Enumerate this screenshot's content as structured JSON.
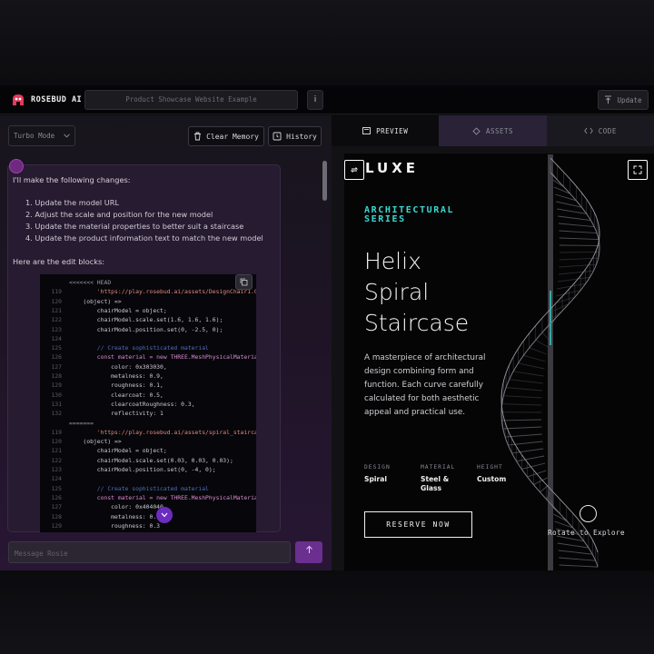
{
  "app": {
    "brand": "ROSEBUD AI",
    "project_title": "Product Showcase Website Example",
    "info_label": "i",
    "update_label": "Update"
  },
  "toolbar": {
    "mode_value": "Turbo Mode",
    "clear_memory_label": "Clear Memory",
    "history_label": "History"
  },
  "chat": {
    "intro": "I'll make the following changes:",
    "steps": [
      "1. Update the model URL",
      "2. Adjust the scale and position for the new model",
      "3. Update the material properties to better suit a staircase",
      "4. Update the product information text to match the new model"
    ],
    "edit_blocks_label": "Here are the edit blocks:",
    "input_placeholder": "Message Rosie"
  },
  "code_lines": [
    {
      "ln": "",
      "text": "<<<<<<< HEAD",
      "cls": "c-marker"
    },
    {
      "ln": "119",
      "text": "        'https://play.rosebud.ai/assets/DesignChair1.Gaybl",
      "cls": "c-str"
    },
    {
      "ln": "120",
      "text": "    (object) =>",
      "cls": "c-def"
    },
    {
      "ln": "121",
      "text": "        chairModel = object;",
      "cls": "c-def"
    },
    {
      "ln": "122",
      "text": "        chairModel.scale.set(1.6, 1.6, 1.6);",
      "cls": "c-def"
    },
    {
      "ln": "123",
      "text": "        chairModel.position.set(0, -2.5, 0);",
      "cls": "c-def"
    },
    {
      "ln": "124",
      "text": "",
      "cls": "c-def"
    },
    {
      "ln": "125",
      "text": "        // Create sophisticated material",
      "cls": "c-com"
    },
    {
      "ln": "126",
      "text": "        const material = new THREE.MeshPhysicalMateria",
      "cls": "c-key"
    },
    {
      "ln": "127",
      "text": "            color: 0x303030,",
      "cls": "c-def"
    },
    {
      "ln": "128",
      "text": "            metalness: 0.9,",
      "cls": "c-def"
    },
    {
      "ln": "129",
      "text": "            roughness: 0.1,",
      "cls": "c-def"
    },
    {
      "ln": "130",
      "text": "            clearcoat: 0.5,",
      "cls": "c-def"
    },
    {
      "ln": "131",
      "text": "            clearcoatRoughness: 0.3,",
      "cls": "c-def"
    },
    {
      "ln": "132",
      "text": "            reflectivity: 1",
      "cls": "c-def"
    },
    {
      "ln": "",
      "text": "=======",
      "cls": "c-marker"
    },
    {
      "ln": "119",
      "text": "        'https://play.rosebud.ai/assets/spiral_staircase_.g",
      "cls": "c-str"
    },
    {
      "ln": "120",
      "text": "    (object) =>",
      "cls": "c-def"
    },
    {
      "ln": "121",
      "text": "        chairModel = object;",
      "cls": "c-def"
    },
    {
      "ln": "122",
      "text": "        chairModel.scale.set(0.03, 0.03, 0.03);",
      "cls": "c-def"
    },
    {
      "ln": "123",
      "text": "        chairModel.position.set(0, -4, 0);",
      "cls": "c-def"
    },
    {
      "ln": "124",
      "text": "",
      "cls": "c-def"
    },
    {
      "ln": "125",
      "text": "        // Create sophisticated material",
      "cls": "c-com"
    },
    {
      "ln": "126",
      "text": "        const material = new THREE.MeshPhysicalMateria",
      "cls": "c-key"
    },
    {
      "ln": "127",
      "text": "            color: 0x404040,",
      "cls": "c-def"
    },
    {
      "ln": "128",
      "text": "            metalness: 0.7,",
      "cls": "c-def"
    },
    {
      "ln": "129",
      "text": "            roughness: 0.3",
      "cls": "c-def"
    }
  ],
  "tabs": [
    {
      "label": "PREVIEW",
      "icon": "preview-icon"
    },
    {
      "label": "ASSETS",
      "icon": "assets-icon"
    },
    {
      "label": "CODE",
      "icon": "code-icon"
    }
  ],
  "preview": {
    "logo": "LUXE",
    "series_line1": "ARCHITECTURAL",
    "series_line2": "SERIES",
    "title_lines": [
      "Helix",
      "Spiral",
      "Staircase"
    ],
    "description": "A masterpiece of architectural design combining form and function. Each curve carefully calculated for both aesthetic appeal and practical use.",
    "specs": [
      {
        "label": "DESIGN",
        "value": "Spiral"
      },
      {
        "label": "MATERIAL",
        "value": "Steel & Glass"
      },
      {
        "label": "HEIGHT",
        "value": "Custom"
      }
    ],
    "cta": "RESERVE NOW",
    "rotate_label": "Rotate to Explore"
  },
  "colors": {
    "accent_teal": "#39d8d0",
    "accent_purple": "#6b2cbf",
    "brand_red": "#e23a5a"
  }
}
